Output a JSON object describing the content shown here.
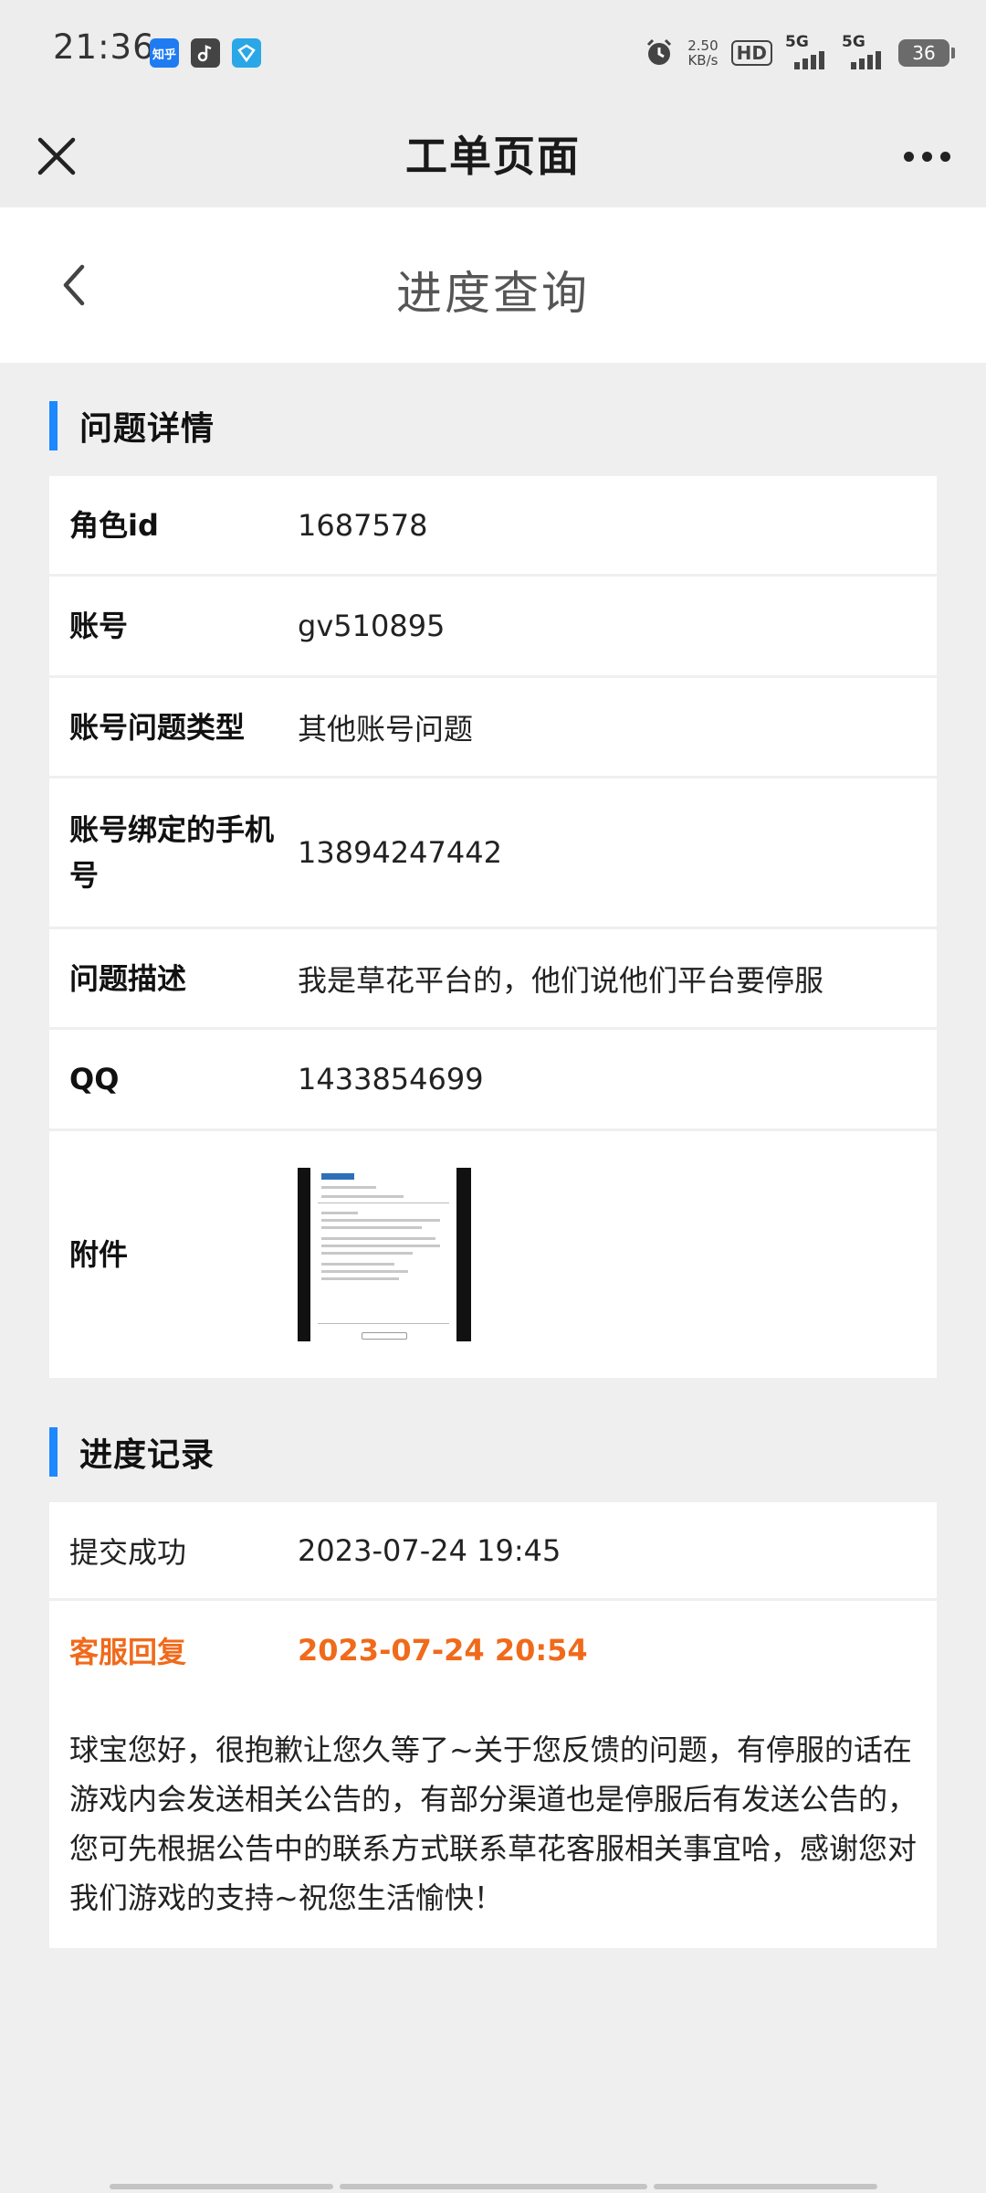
{
  "status_bar": {
    "time": "21:36",
    "apps": [
      {
        "icon": "zhihu-icon",
        "label": "知乎",
        "color": "#1e7bf2"
      },
      {
        "icon": "music-note-icon",
        "label": "",
        "color": "#444444"
      },
      {
        "icon": "travel-app-icon",
        "label": "",
        "color": "#2aa7e6"
      }
    ],
    "network_speed_value": "2.50",
    "network_speed_unit": "KB/s",
    "hd_label": "HD",
    "sim1_label": "5G",
    "sim2_label": "5G",
    "battery": "36"
  },
  "app_bar": {
    "title": "工单页面"
  },
  "page_header": {
    "title": "进度查询"
  },
  "details_section": {
    "title": "问题详情",
    "rows": [
      {
        "label": "角色id",
        "value": "1687578"
      },
      {
        "label": "账号",
        "value": "gv510895"
      },
      {
        "label": "账号问题类型",
        "value": "其他账号问题"
      },
      {
        "label": "账号绑定的手机号",
        "value": "13894247442"
      },
      {
        "label": "问题描述",
        "value": "我是草花平台的，他们说他们平台要停服"
      },
      {
        "label": "QQ",
        "value": "1433854699"
      }
    ],
    "attachment_label": "附件"
  },
  "progress_section": {
    "title": "进度记录",
    "submitted_label": "提交成功",
    "submitted_time": "2023-07-24 19:45",
    "reply_label": "客服回复",
    "reply_time": "2023-07-24 20:54",
    "reply_text": "球宝您好，很抱歉让您久等了~关于您反馈的问题，有停服的话在游戏内会发送相关公告的，有部分渠道也是停服后有发送公告的，您可先根据公告中的联系方式联系草花客服相关事宜哈，感谢您对我们游戏的支持~祝您生活愉快！"
  },
  "colors": {
    "accent_blue": "#1e88ff",
    "reply_orange": "#f06a1b",
    "background": "#efefef"
  }
}
